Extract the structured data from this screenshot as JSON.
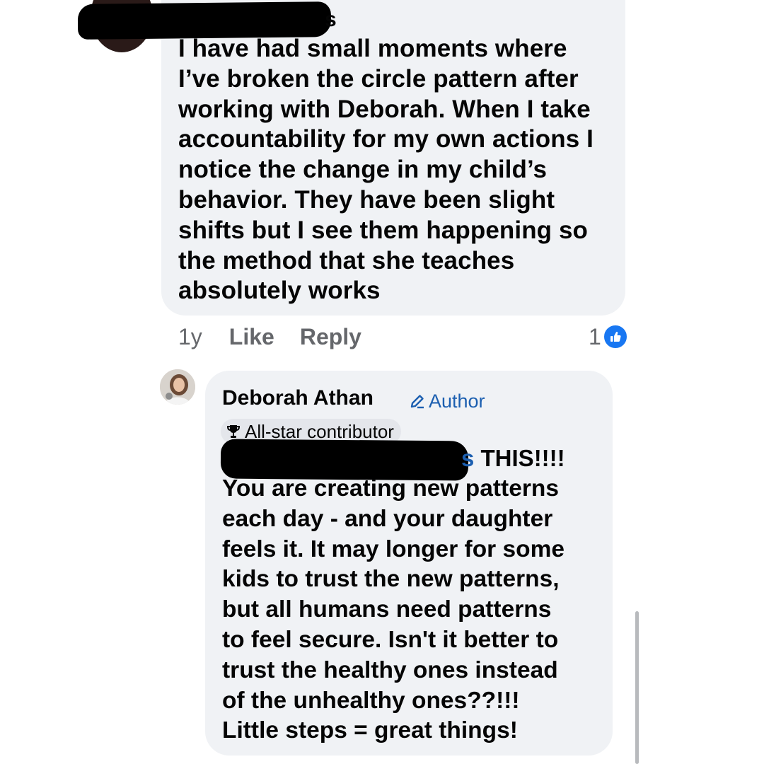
{
  "comment": {
    "name_suffix": "s",
    "text": "I have had small moments where\nI’ve broken the circle pattern after\nworking with Deborah. When I take\naccountability for my own actions I\nnotice the change in my child’s\nbehavior.  They have been slight\nshifts but I see them happening so\nthe method that she teaches\nabsolutely works",
    "age": "1y",
    "like_label": "Like",
    "reply_label": "Reply",
    "reaction_count": "1",
    "reaction_icon": "thumbs-up-icon",
    "reaction_color": "#1877f2"
  },
  "reply": {
    "author_name": "Deborah Athan",
    "author_badge": "Author",
    "contributor_badge": "All-star contributor",
    "mention_suffix": "s",
    "first_line_rest": " THIS!!!!",
    "text": "You are creating new patterns\neach day - and your daughter\nfeels it. It may longer for some\nkids to trust the new patterns,\nbut all humans need patterns\nto feel secure. Isn't it better to\ntrust the healthy ones instead\nof the unhealthy ones??!!!\nLittle steps = great things!",
    "link_color": "#1c5fb0"
  }
}
